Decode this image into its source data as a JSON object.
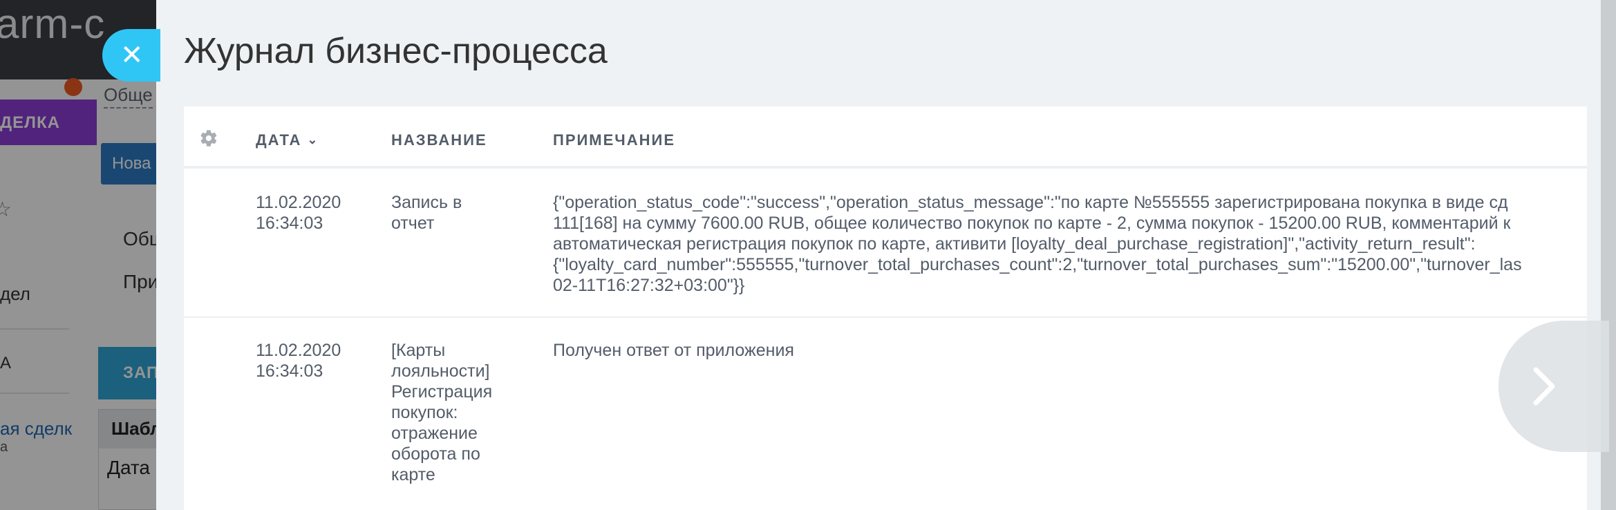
{
  "background": {
    "header_text": "arm-c",
    "deal_tab": "ДЕЛКА",
    "general_link": "Обще",
    "new_button": "Нова",
    "side_item_1": "Общ",
    "side_item_2": "При",
    "left_row_1": "дел",
    "left_row_2": "А",
    "record_button": "ЗАП",
    "left_link": "ая сделк",
    "left_link_sub": "а",
    "table_head": "Шабл",
    "table_row": "Дата"
  },
  "panel": {
    "title": "Журнал бизнес-процесса",
    "columns": {
      "date": "ДАТА",
      "name": "НАЗВАНИЕ",
      "note": "ПРИМЕЧАНИЕ"
    },
    "rows": [
      {
        "date": "11.02.2020\n16:34:03",
        "name": "Запись в\nотчет",
        "note": "{\"operation_status_code\":\"success\",\"operation_status_message\":\"по карте №555555 зарегистрирована покупка в виде сд\n111[168] на сумму 7600.00 RUB, общее количество покупок по карте - 2, сумма покупок - 15200.00 RUB, комментарий к\nавтоматическая регистрация покупок по карте, активити [loyalty_deal_purchase_registration]\",\"activity_return_result\":\n{\"loyalty_card_number\":555555,\"turnover_total_purchases_count\":2,\"turnover_total_purchases_sum\":\"15200.00\",\"turnover_las\n02-11T16:27:32+03:00\"}}"
      },
      {
        "date": "11.02.2020\n16:34:03",
        "name": "[Карты\nлояльности]\nРегистрация\nпокупок:\nотражение\nоборота по\nкарте",
        "note": "Получен ответ от приложения"
      }
    ]
  },
  "icons": {
    "close": "close-icon",
    "gear": "gear-icon",
    "sort": "chevron-down-icon",
    "next": "chevron-right-icon"
  },
  "colors": {
    "accent": "#2fc6f6",
    "panel_bg": "#eef2f4",
    "text": "#535c69"
  }
}
